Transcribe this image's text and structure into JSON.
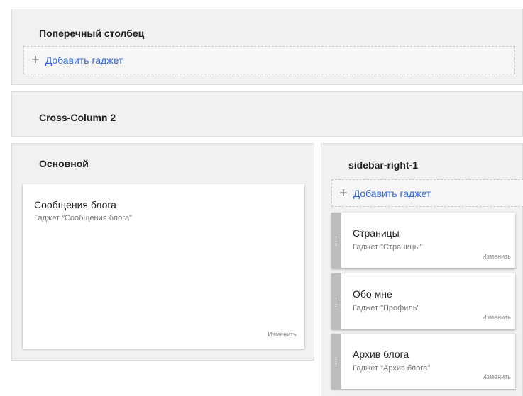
{
  "cross_column_1": {
    "title": "Поперечный столбец",
    "add_label": "Добавить гаджет"
  },
  "cross_column_2": {
    "title": "Cross-Column 2"
  },
  "main": {
    "title": "Основной",
    "gadget": {
      "title": "Сообщения блога",
      "subtitle": "Гаджет \"Сообщения блога\"",
      "edit_label": "Изменить"
    }
  },
  "sidebar": {
    "title": "sidebar-right-1",
    "add_label": "Добавить гаджет",
    "gadgets": [
      {
        "title": "Страницы",
        "subtitle": "Гаджет \"Страницы\"",
        "edit_label": "Изменить"
      },
      {
        "title": "Обо мне",
        "subtitle": "Гаджет \"Профиль\"",
        "edit_label": "Изменить"
      },
      {
        "title": "Архив блога",
        "subtitle": "Гаджет \"Архив блога\"",
        "edit_label": "Изменить"
      }
    ]
  },
  "icons": {
    "add": "plus-icon",
    "drag": "drag-handle-icon"
  }
}
